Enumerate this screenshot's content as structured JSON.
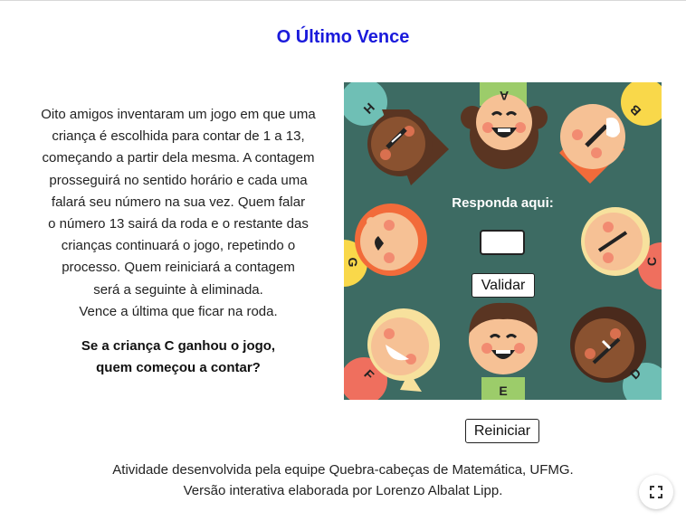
{
  "title": "O Último Vence",
  "problem_lines": [
    "Oito amigos inventaram um jogo em que uma",
    "criança é escolhida para contar de 1 a 13,",
    "começando a partir dela mesma. A contagem",
    "prosseguirá no sentido horário e cada uma",
    "falará seu número na sua vez. Quem falar",
    "o número 13 sairá da roda e o restante das",
    "crianças continuará o jogo, repetindo o",
    "processo. Quem reiniciará a contagem",
    "será a seguinte à eliminada.",
    "Vence a última que ficar na roda."
  ],
  "question_lines": [
    "Se a criança C ganhou o jogo,",
    "quem começou a contar?"
  ],
  "board": {
    "prompt": "Responda aqui:",
    "answer_value": "",
    "validate_label": "Validar",
    "background_color": "#3d6b63",
    "children": [
      {
        "letter": "A",
        "icon": "child-face-icon"
      },
      {
        "letter": "B",
        "icon": "child-face-icon"
      },
      {
        "letter": "C",
        "icon": "child-face-icon"
      },
      {
        "letter": "D",
        "icon": "child-face-icon"
      },
      {
        "letter": "E",
        "icon": "child-face-icon"
      },
      {
        "letter": "F",
        "icon": "child-face-icon"
      },
      {
        "letter": "G",
        "icon": "child-face-icon"
      },
      {
        "letter": "H",
        "icon": "child-face-icon"
      }
    ]
  },
  "reset_label": "Reiniciar",
  "credits": [
    "Atividade desenvolvida pela equipe Quebra-cabeças de Matemática, UFMG.",
    "Versão interativa elaborada por Lorenzo Albalat Lipp."
  ],
  "fullscreen_icon": "fullscreen-icon"
}
